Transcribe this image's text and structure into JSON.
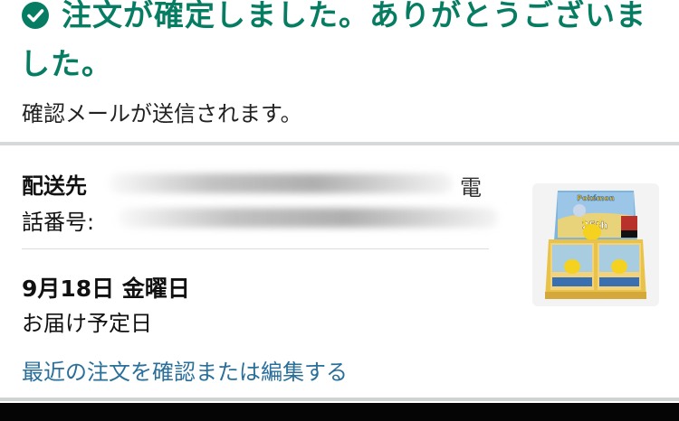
{
  "confirmation": {
    "headline": "注文が確定しました。ありがとうございました。",
    "message": "確認メールが送信されます。"
  },
  "shipping": {
    "label": "配送先",
    "phone_tail": "電",
    "phone_label": "話番号:"
  },
  "delivery": {
    "date": "9月18日 金曜日",
    "caption": "お届け予定日"
  },
  "links": {
    "orders": "最近の注文を確認または編集する"
  },
  "product": {
    "logo_text": "Pokémon",
    "badge_text": "25th"
  },
  "colors": {
    "success": "#067d62",
    "link": "#2a6f9a",
    "divider": "#d5d9d9"
  }
}
